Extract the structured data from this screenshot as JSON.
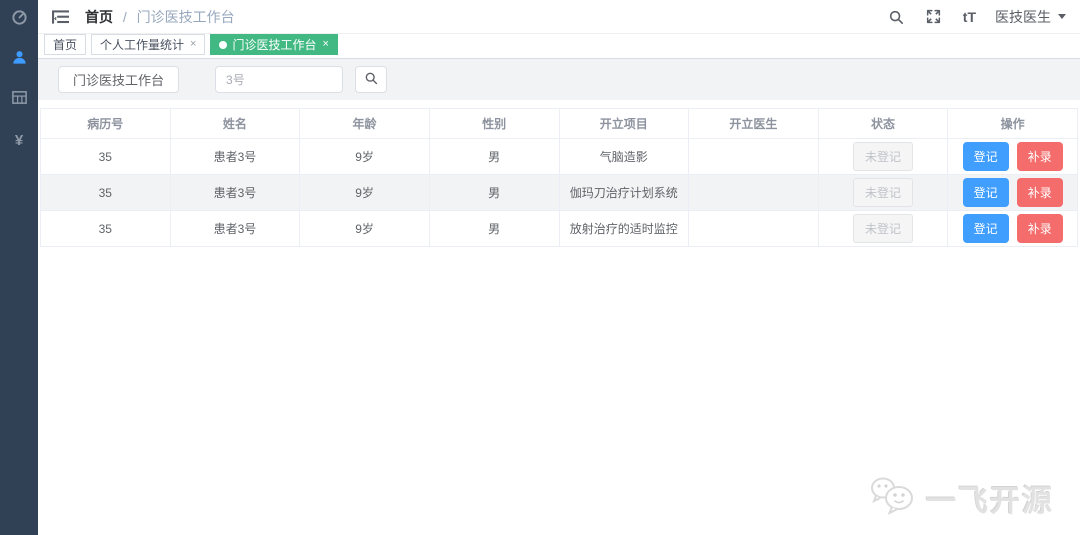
{
  "header": {
    "breadcrumb": {
      "root": "首页",
      "separator": "/",
      "current": "门诊医技工作台"
    },
    "user_name": "医技医生"
  },
  "icons": {
    "close": "×",
    "font_size": "tT",
    "yuan": "¥"
  },
  "tabs": [
    {
      "label": "首页",
      "closable": false,
      "active": false
    },
    {
      "label": "个人工作量统计",
      "closable": true,
      "active": false
    },
    {
      "label": "门诊医技工作台",
      "closable": true,
      "active": true
    }
  ],
  "toolbar": {
    "workbench_button": "门诊医技工作台",
    "search_value": "3号"
  },
  "table": {
    "columns": [
      "病历号",
      "姓名",
      "年龄",
      "性别",
      "开立项目",
      "开立医生",
      "状态",
      "操作"
    ],
    "actions": {
      "register": "登记",
      "supplement": "补录"
    },
    "rows": [
      {
        "record_no": "35",
        "name": "患者3号",
        "age": "9岁",
        "gender": "男",
        "project": "气脑造影",
        "doctor": "",
        "status": "未登记"
      },
      {
        "record_no": "35",
        "name": "患者3号",
        "age": "9岁",
        "gender": "男",
        "project": "伽玛刀治疗计划系统",
        "doctor": "",
        "status": "未登记"
      },
      {
        "record_no": "35",
        "name": "患者3号",
        "age": "9岁",
        "gender": "男",
        "project": "放射治疗的适时监控",
        "doctor": "",
        "status": "未登记"
      }
    ]
  },
  "watermark": {
    "text": "一飞开源"
  },
  "colors": {
    "sidebar_bg": "#304156",
    "accent_blue": "#409eff",
    "danger_red": "#f56c6c",
    "active_tab_green": "#42b983",
    "breadcrumb_muted": "#97a8be"
  }
}
